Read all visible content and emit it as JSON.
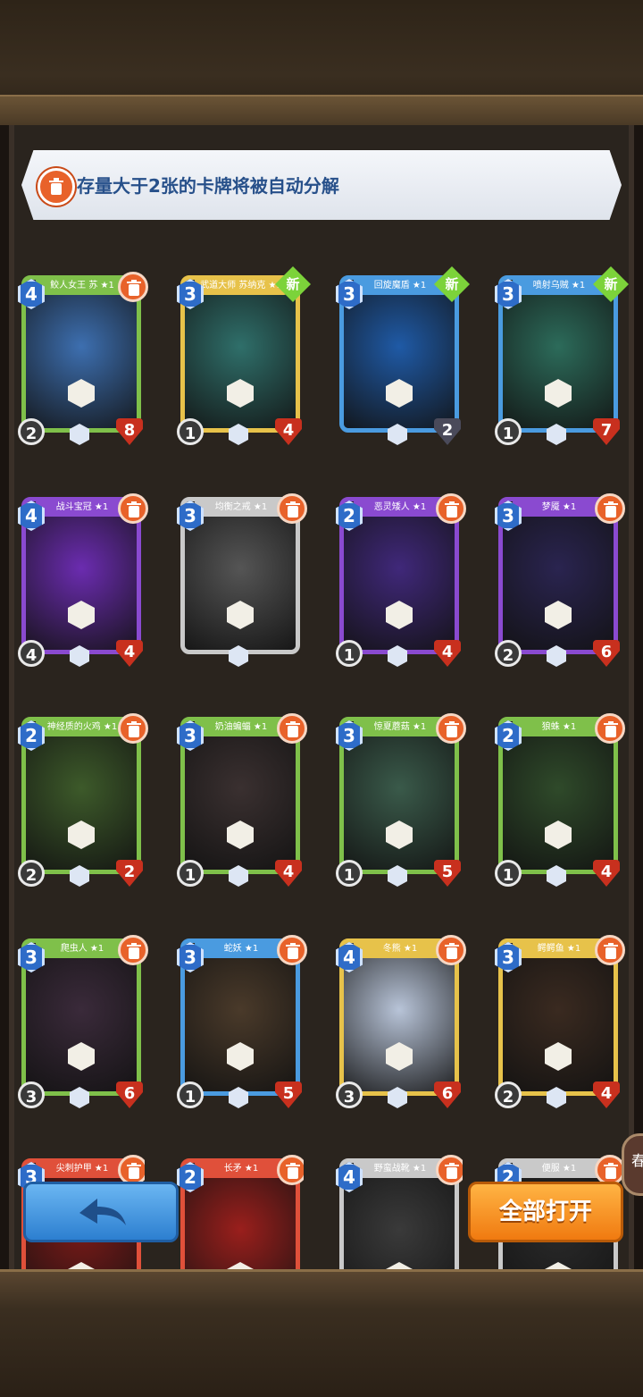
{
  "notice": {
    "text": "存量大于2张的卡牌将被自动分解"
  },
  "new_label": "新",
  "cards": [
    {
      "name": "鲛人女王 苏 ★1",
      "cost": "4",
      "atk": "2",
      "hp": "8",
      "color": "#7fc04a",
      "art": "#3d6fb0",
      "is_new": false
    },
    {
      "name": "武道大师 苏纳克 ★1",
      "cost": "3",
      "atk": "1",
      "hp": "4",
      "color": "#e7c24a",
      "art": "#2f6f6a",
      "is_new": true
    },
    {
      "name": "回旋魔盾 ★1",
      "cost": "3",
      "atk": "",
      "hp": "2",
      "color": "#4a9be0",
      "art": "#1f5aa6",
      "is_new": true
    },
    {
      "name": "喷射乌贼 ★1",
      "cost": "3",
      "atk": "1",
      "hp": "7",
      "color": "#4a9be0",
      "art": "#2c6b5a",
      "is_new": true
    },
    {
      "name": "战斗宝冠 ★1",
      "cost": "4",
      "atk": "4",
      "hp": "4",
      "color": "#8a4ad0",
      "art": "#6b2cb0",
      "is_new": false
    },
    {
      "name": "均衡之戒 ★1",
      "cost": "3",
      "atk": "",
      "hp": "",
      "color": "#c9c9c9",
      "art": "#555555",
      "is_new": false
    },
    {
      "name": "恶灵矮人 ★1",
      "cost": "2",
      "atk": "1",
      "hp": "4",
      "color": "#8a4ad0",
      "art": "#40287a",
      "is_new": false
    },
    {
      "name": "梦魇 ★1",
      "cost": "3",
      "atk": "2",
      "hp": "6",
      "color": "#8a4ad0",
      "art": "#2a2450",
      "is_new": false
    },
    {
      "name": "神经质的火鸡 ★1",
      "cost": "2",
      "atk": "2",
      "hp": "2",
      "color": "#7fc04a",
      "art": "#3d5a2a",
      "is_new": false
    },
    {
      "name": "奶油蝙蝠 ★1",
      "cost": "3",
      "atk": "1",
      "hp": "4",
      "color": "#7fc04a",
      "art": "#3a3030",
      "is_new": false
    },
    {
      "name": "惊夏蘑菇 ★1",
      "cost": "3",
      "atk": "1",
      "hp": "5",
      "color": "#7fc04a",
      "art": "#3a5a4a",
      "is_new": false
    },
    {
      "name": "狼蛛 ★1",
      "cost": "2",
      "atk": "1",
      "hp": "4",
      "color": "#7fc04a",
      "art": "#2f4a2a",
      "is_new": false
    },
    {
      "name": "爬虫人 ★1",
      "cost": "3",
      "atk": "3",
      "hp": "6",
      "color": "#7fc04a",
      "art": "#3a2a3a",
      "is_new": false
    },
    {
      "name": "蛇妖 ★1",
      "cost": "3",
      "atk": "1",
      "hp": "5",
      "color": "#4a9be0",
      "art": "#4a3a2a",
      "is_new": false
    },
    {
      "name": "冬熊 ★1",
      "cost": "4",
      "atk": "3",
      "hp": "6",
      "color": "#e7c24a",
      "art": "#b8c4d8",
      "is_new": false
    },
    {
      "name": "鳄鳄鱼 ★1",
      "cost": "3",
      "atk": "2",
      "hp": "4",
      "color": "#e7c24a",
      "art": "#3a2a20",
      "is_new": false
    },
    {
      "name": "尖刺护甲 ★1",
      "cost": "3",
      "atk": "",
      "hp": "",
      "color": "#e0503a",
      "art": "#7a1a18",
      "is_new": false
    },
    {
      "name": "长矛 ★1",
      "cost": "2",
      "atk": "",
      "hp": "",
      "color": "#e0503a",
      "art": "#9a1f1c",
      "is_new": false
    },
    {
      "name": "野蛮战靴 ★1",
      "cost": "4",
      "atk": "",
      "hp": "",
      "color": "#c9c9c9",
      "art": "#3a3a3a",
      "is_new": false
    },
    {
      "name": "便服 ★1",
      "cost": "2",
      "atk": "",
      "hp": "",
      "color": "#c9c9c9",
      "art": "#2a2a2a",
      "is_new": false
    }
  ],
  "buttons": {
    "open_all": "全部打开",
    "back_icon": "back-arrow-icon"
  },
  "side_tab": {
    "text": "春"
  }
}
